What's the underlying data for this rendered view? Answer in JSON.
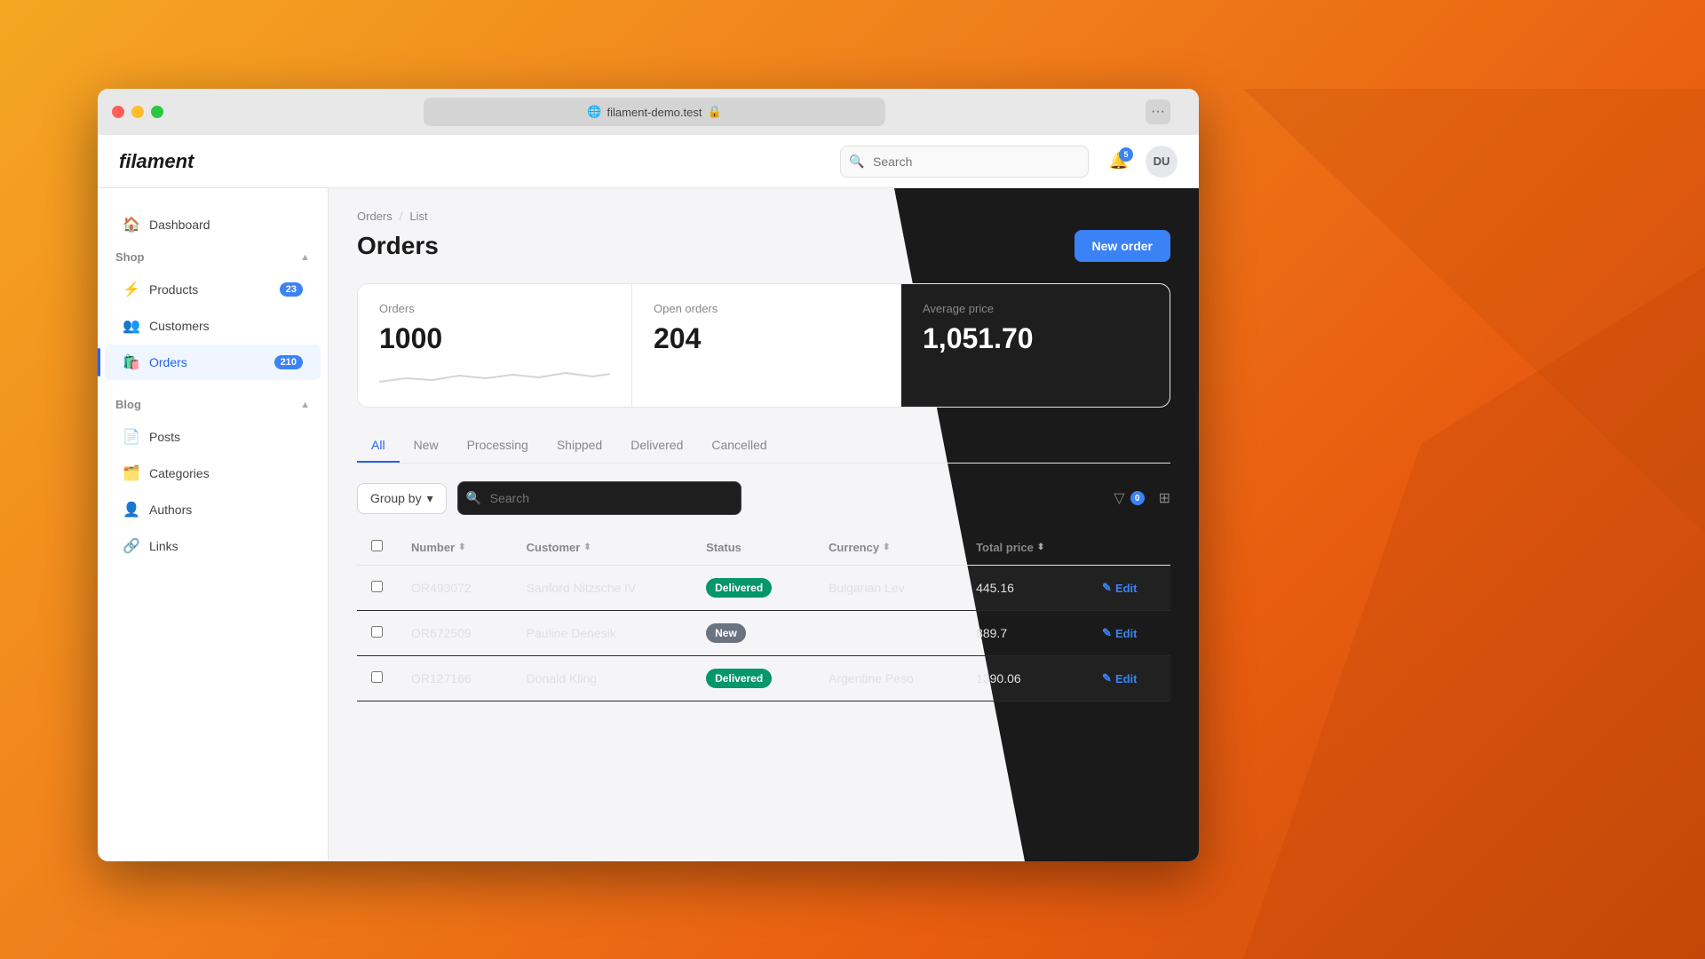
{
  "browser": {
    "url": "filament-demo.test",
    "dots_label": "···"
  },
  "app": {
    "brand": "filament",
    "top_search_placeholder": "Search"
  },
  "notifications": {
    "count": "5"
  },
  "user": {
    "initials": "DU"
  },
  "sidebar": {
    "dashboard_label": "Dashboard",
    "sections": [
      {
        "label": "Shop",
        "items": [
          {
            "id": "products",
            "label": "Products",
            "badge": "23",
            "icon": "⚡"
          },
          {
            "id": "customers",
            "label": "Customers",
            "badge": null,
            "icon": "👥"
          },
          {
            "id": "orders",
            "label": "Orders",
            "badge": "210",
            "icon": "🛍️",
            "active": true
          }
        ]
      },
      {
        "label": "Blog",
        "items": [
          {
            "id": "posts",
            "label": "Posts",
            "badge": null,
            "icon": "📄"
          },
          {
            "id": "categories",
            "label": "Categories",
            "badge": null,
            "icon": "🗂️"
          },
          {
            "id": "authors",
            "label": "Authors",
            "badge": null,
            "icon": "👤"
          },
          {
            "id": "links",
            "label": "Links",
            "badge": null,
            "icon": "🔗"
          }
        ]
      }
    ]
  },
  "breadcrumb": {
    "items": [
      "Orders",
      "List"
    ]
  },
  "page": {
    "title": "Orders",
    "new_order_label": "New order"
  },
  "stats": [
    {
      "label": "Orders",
      "value": "1000"
    },
    {
      "label": "Open orders",
      "value": "204"
    },
    {
      "label": "Average price",
      "value": "1,051.70"
    }
  ],
  "tabs": [
    {
      "label": "All",
      "active": true
    },
    {
      "label": "New"
    },
    {
      "label": "Processing"
    },
    {
      "label": "Shipped"
    },
    {
      "label": "Delivered"
    },
    {
      "label": "Cancelled"
    }
  ],
  "toolbar": {
    "group_by_label": "Group by",
    "search_placeholder": "Search",
    "filter_count": "0"
  },
  "table": {
    "columns": [
      {
        "label": "Number",
        "sortable": true
      },
      {
        "label": "Customer",
        "sortable": true
      },
      {
        "label": "Status"
      },
      {
        "label": "Currency",
        "sortable": true
      },
      {
        "label": "Total price",
        "sortable": true
      }
    ],
    "rows": [
      {
        "number": "OR493072",
        "customer": "Sanford Nitzsche IV",
        "status": "Delivered",
        "status_class": "delivered",
        "currency": "Bulgarian Lev",
        "total": "445.16"
      },
      {
        "number": "OR672509",
        "customer": "Pauline Denesik",
        "status": "New",
        "status_class": "new",
        "currency": "",
        "total": "889.7"
      },
      {
        "number": "OR127166",
        "customer": "Donald Kling",
        "status": "Delivered",
        "status_class": "delivered",
        "currency": "Argentine Peso",
        "total": "1390.06"
      }
    ],
    "edit_label": "Edit"
  }
}
